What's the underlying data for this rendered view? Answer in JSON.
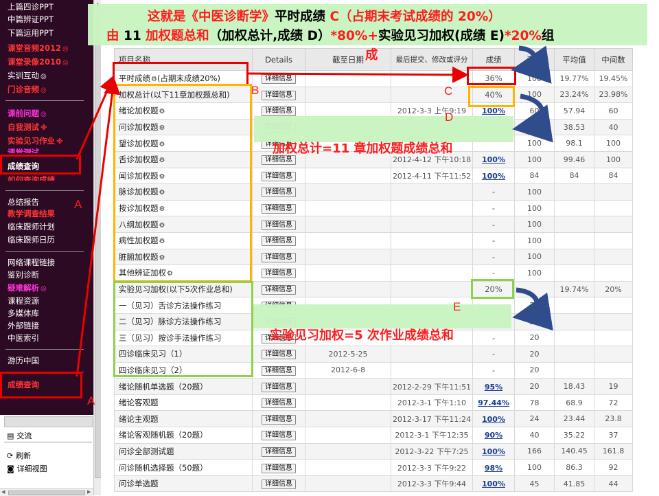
{
  "sidebar": {
    "items": [
      {
        "label": "上篇四诊PPT",
        "style": "white"
      },
      {
        "label": "中篇辨证PPT",
        "style": "white"
      },
      {
        "label": "下篇运用PPT",
        "style": "white"
      },
      {
        "label": "课堂音频2012",
        "style": "red",
        "mark": "◎"
      },
      {
        "label": "课堂录像2010",
        "style": "red",
        "mark": "◎"
      },
      {
        "label": "实训互动",
        "style": "white",
        "mark": "◎"
      },
      {
        "label": "门诊音频",
        "style": "red",
        "mark": "◎"
      },
      {
        "label": "课前问题",
        "style": "magenta",
        "mark": "◎"
      },
      {
        "label": "自我测试",
        "style": "red",
        "mark": "※"
      },
      {
        "label": "实验见习作业",
        "style": "red",
        "mark": "※"
      },
      {
        "label": "课堂测试",
        "style": "magenta"
      },
      {
        "label": "成绩查询",
        "style": "white-bold"
      },
      {
        "label": "如何查询成绩",
        "style": "red"
      },
      {
        "label": "总结报告",
        "style": "white"
      },
      {
        "label": "教学调查结果",
        "style": "red"
      },
      {
        "label": "临床跟师计划",
        "style": "white"
      },
      {
        "label": "临床跟师日历",
        "style": "white"
      },
      {
        "label": "网络课程链接",
        "style": "white"
      },
      {
        "label": "鉴别诊断",
        "style": "white"
      },
      {
        "label": "疑难解析",
        "style": "magenta",
        "mark": "◎"
      },
      {
        "label": "课程资源",
        "style": "white"
      },
      {
        "label": "多媒体库",
        "style": "white"
      },
      {
        "label": "外部链接",
        "style": "white"
      },
      {
        "label": "中医索引",
        "style": "white"
      },
      {
        "label": "游历中国",
        "style": "white"
      },
      {
        "label": "成绩查询",
        "style": "red"
      }
    ]
  },
  "bottom_panel": {
    "items": [
      {
        "label": "交流",
        "icon": "list-icon"
      },
      {
        "label": "刷新",
        "icon": "refresh-icon"
      },
      {
        "label": "详细视图",
        "icon": "detail-view-icon"
      }
    ]
  },
  "table": {
    "headers": [
      "项目名称",
      "Details",
      "截至日期",
      "最后提交、修改或评分",
      "成绩",
      "满分",
      "平均值",
      "中间数"
    ],
    "details_label": "详细信息",
    "rows": [
      {
        "name": "平时成绩",
        "gear": true,
        "suffix": "(占期末成绩20%)",
        "date": "",
        "subm": "",
        "score": "36%",
        "score_link": false,
        "max": "100",
        "avg": "19.77%",
        "median": "19.45%"
      },
      {
        "name": "加权总计(以下11章加权题总和)",
        "gear": false,
        "date": "",
        "subm": "",
        "score": "40%",
        "score_link": false,
        "max": "100",
        "avg": "23.24%",
        "median": "23.98%"
      },
      {
        "name": "绪论加权题",
        "gear": true,
        "date": "",
        "subm": "2012-3-3 上午9:19",
        "score": "100%",
        "score_link": true,
        "max": "60",
        "avg": "57.94",
        "median": "60"
      },
      {
        "name": "问诊加权题",
        "gear": true,
        "date": "",
        "subm": "",
        "score": "",
        "score_link": false,
        "max": "",
        "avg": "38.53",
        "median": "40"
      },
      {
        "name": "望诊加权题",
        "gear": true,
        "date": "",
        "subm": "",
        "score": "",
        "score_link": false,
        "max": "100",
        "avg": "98.1",
        "median": "100"
      },
      {
        "name": "舌诊加权题",
        "gear": true,
        "date": "",
        "subm": "2012-4-12 下午10:18",
        "score": "100%",
        "score_link": true,
        "max": "100",
        "avg": "99.46",
        "median": "100"
      },
      {
        "name": "闻诊加权题",
        "gear": true,
        "date": "",
        "subm": "2012-4-11 下午11:52",
        "score": "100%",
        "score_link": true,
        "max": "84",
        "avg": "84",
        "median": "84"
      },
      {
        "name": "脉诊加权题",
        "gear": true,
        "date": "",
        "subm": "",
        "score": "-",
        "score_link": false,
        "max": "100",
        "avg": "",
        "median": ""
      },
      {
        "name": "按诊加权题",
        "gear": true,
        "date": "",
        "subm": "",
        "score": "-",
        "score_link": false,
        "max": "100",
        "avg": "",
        "median": ""
      },
      {
        "name": "八纲加权题",
        "gear": true,
        "date": "",
        "subm": "",
        "score": "-",
        "score_link": false,
        "max": "100",
        "avg": "",
        "median": ""
      },
      {
        "name": "病性加权题",
        "gear": true,
        "date": "",
        "subm": "",
        "score": "-",
        "score_link": false,
        "max": "100",
        "avg": "",
        "median": ""
      },
      {
        "name": "脏腑加权题",
        "gear": true,
        "date": "",
        "subm": "",
        "score": "-",
        "score_link": false,
        "max": "100",
        "avg": "",
        "median": ""
      },
      {
        "name": "其他辨证加权",
        "gear": true,
        "date": "",
        "subm": "",
        "score": "-",
        "score_link": false,
        "max": "100",
        "avg": "",
        "median": ""
      },
      {
        "name": "实验见习加权(以下5次作业总和)",
        "gear": false,
        "date": "",
        "subm": "",
        "score": "20%",
        "score_link": false,
        "max": "",
        "avg": "19.74%",
        "median": "20%"
      },
      {
        "name": "一（见习）舌诊方法操作练习",
        "gear": false,
        "date": "",
        "subm": "",
        "score": "",
        "score_link": false,
        "max": "20",
        "avg": "",
        "median": ""
      },
      {
        "name": "二（见习）脉诊方法操作练习",
        "gear": false,
        "date": "",
        "subm": "",
        "score": "",
        "score_link": false,
        "max": "20",
        "avg": "",
        "median": ""
      },
      {
        "name": "三（见习）按诊手法操作练习",
        "gear": false,
        "date": "",
        "subm": "",
        "score": "-",
        "score_link": false,
        "max": "20",
        "avg": "",
        "median": ""
      },
      {
        "name": "四诊临床见习（1）",
        "gear": false,
        "date": "2012-5-25",
        "subm": "",
        "score": "-",
        "score_link": false,
        "max": "20",
        "avg": "",
        "median": ""
      },
      {
        "name": "四诊临床见习（2）",
        "gear": false,
        "date": "2012-6-8",
        "subm": "",
        "score": "-",
        "score_link": false,
        "max": "20",
        "avg": "",
        "median": ""
      },
      {
        "name": "绪论随机单选题（20题）",
        "gear": false,
        "date": "",
        "subm": "2012-2-29 下午11:51",
        "score": "95%",
        "score_link": true,
        "max": "20",
        "avg": "18.43",
        "median": "19"
      },
      {
        "name": "绪论客观题",
        "gear": false,
        "date": "",
        "subm": "2012-3-1 下午1:10",
        "score": "97.44%",
        "score_link": true,
        "max": "78",
        "avg": "68.9",
        "median": "72"
      },
      {
        "name": "绪论主观题",
        "gear": false,
        "date": "",
        "subm": "2012-3-17 下午11:24",
        "score": "100%",
        "score_link": true,
        "max": "24",
        "avg": "23.44",
        "median": "23.8"
      },
      {
        "name": "绪论客观随机题（20题）",
        "gear": false,
        "date": "",
        "subm": "2012-3-1 下午12:35",
        "score": "90%",
        "score_link": true,
        "max": "40",
        "avg": "35.22",
        "median": "37"
      },
      {
        "name": "问诊全部测试题",
        "gear": false,
        "date": "",
        "subm": "2012-3-22 下午7:25",
        "score": "100%",
        "score_link": true,
        "max": "166",
        "avg": "140.45",
        "median": "161.8"
      },
      {
        "name": "问诊随机选择题（50题）",
        "gear": false,
        "date": "",
        "subm": "2012-3-3 下午9:22",
        "score": "98%",
        "score_link": true,
        "max": "100",
        "avg": "86.3",
        "median": "92"
      },
      {
        "name": "问诊单选题",
        "gear": false,
        "date": "",
        "subm": "2012-3-3 下午9:44",
        "score": "100%",
        "score_link": true,
        "max": "45",
        "avg": "41.85",
        "median": "44"
      }
    ]
  },
  "annotations": {
    "top_line1_a": "这就是《中医诊断学》",
    "top_line1_b": "平时成绩 ",
    "top_line1_c": "C（占期末考试成绩的 20%）",
    "top_line2_a": "由 ",
    "top_line2_b": "11 ",
    "top_line2_c": "加权题总和",
    "top_line2_d": "（加权总计,成绩 D）",
    "top_line2_e": "*80%+",
    "top_line2_f": "实验见习加权(成绩 E)",
    "top_line2_g": "*20%",
    "top_line2_h": "组",
    "top_line3": "成",
    "middle": "加权总计=11 章加权题成绩总和",
    "bottom": "实验见习加权=5 次作业成绩总和",
    "letters": {
      "a": "A",
      "b": "B",
      "c": "C",
      "d": "D",
      "e": "E"
    },
    "colors": {
      "red": "#ff1c1c",
      "orange": "#ffb400",
      "green": "#8ed14c",
      "green_fill": "#c8f4c0",
      "arrow_blue": "#2f4d8c"
    }
  }
}
